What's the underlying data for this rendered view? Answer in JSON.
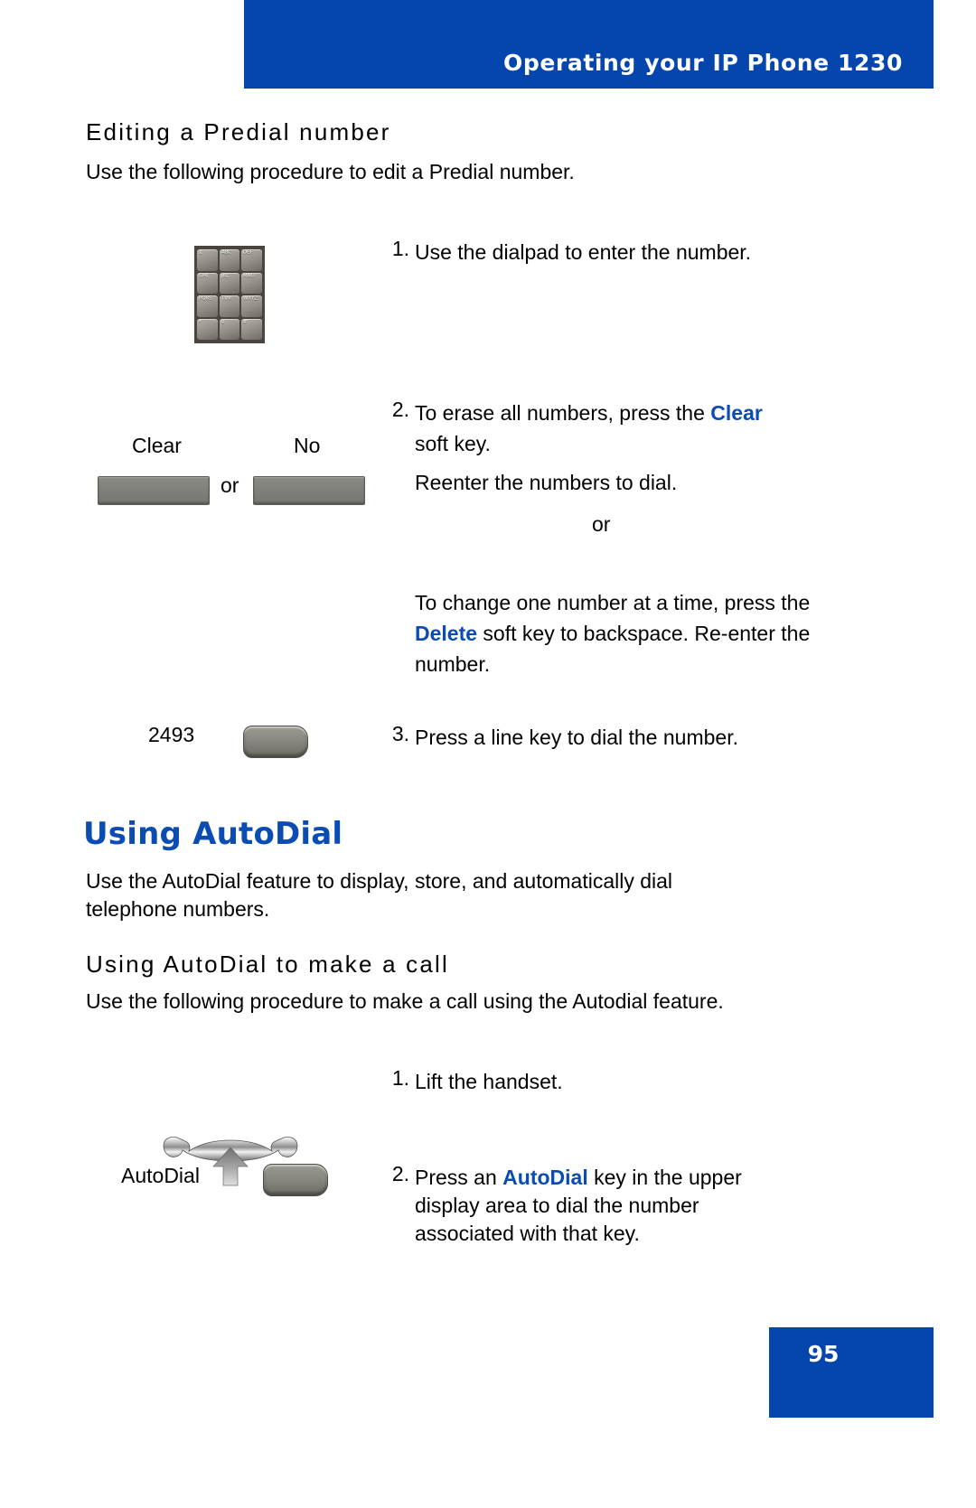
{
  "header": {
    "title": "Operating your IP Phone 1230",
    "banner_color": "#0546ae"
  },
  "page_footer": {
    "page_number": "95",
    "box_color": "#0546ae"
  },
  "sections": [
    {
      "id": "editing-predial",
      "heading": "Editing a Predial number",
      "intro": "Use the following procedure to edit a Predial number.",
      "steps": [
        {
          "number": "1.",
          "lines": [
            "Use the dialpad to enter the number."
          ],
          "art": "dialpad-image"
        },
        {
          "number": "2.",
          "line_a_pre": "To erase all numbers, press the ",
          "line_a_kw": "Clear",
          "line_a_post": "",
          "line_b": "soft key.",
          "line_c": "Reenter the numbers to dial.",
          "line_d": "or",
          "line_e_pre": "To change one number at a time, press the ",
          "line_e_kw": "Delete",
          "line_e_post": " soft key to backspace. Re-enter the number.",
          "art_labels": {
            "left": "Clear",
            "right": "No",
            "between": "or"
          }
        },
        {
          "number": "3.",
          "lines": [
            "Press a line key to dial the number."
          ],
          "art_label": "2493"
        }
      ]
    },
    {
      "id": "using-autodial",
      "heading": "Using AutoDial",
      "intro_line1": "Use the AutoDial feature to display, store, and automatically dial",
      "intro_line2": "telephone numbers.",
      "subsection": {
        "heading": "Using AutoDial to make a call",
        "intro": "Use the following procedure to make a call using the Autodial feature.",
        "steps": [
          {
            "number": "1.",
            "lines": [
              "Lift the handset."
            ],
            "art": "handset-image"
          },
          {
            "number": "2.",
            "line_a_pre": "Press an ",
            "line_a_kw": "AutoDial",
            "line_a_post": " key in the upper",
            "line_b": "display area to dial the number",
            "line_c": "associated with that key.",
            "art_label": "AutoDial"
          }
        ]
      }
    }
  ],
  "dialpad_keys": [
    {
      "digit": "1",
      "letters": ""
    },
    {
      "digit": "2",
      "letters": "ABC"
    },
    {
      "digit": "3",
      "letters": "DEF"
    },
    {
      "digit": "4",
      "letters": "GHI"
    },
    {
      "digit": "5",
      "letters": "JKL"
    },
    {
      "digit": "6",
      "letters": "MNO"
    },
    {
      "digit": "7",
      "letters": "PQRS"
    },
    {
      "digit": "8",
      "letters": "TUV"
    },
    {
      "digit": "9",
      "letters": "WXYZ"
    },
    {
      "digit": "*",
      "letters": ""
    },
    {
      "digit": "0",
      "letters": ""
    },
    {
      "digit": "#",
      "letters": ""
    }
  ],
  "colors": {
    "accent_blue": "#0b4cb3",
    "banner_blue": "#0546ae",
    "text_black": "#000000",
    "key_grey": "#83837e"
  }
}
